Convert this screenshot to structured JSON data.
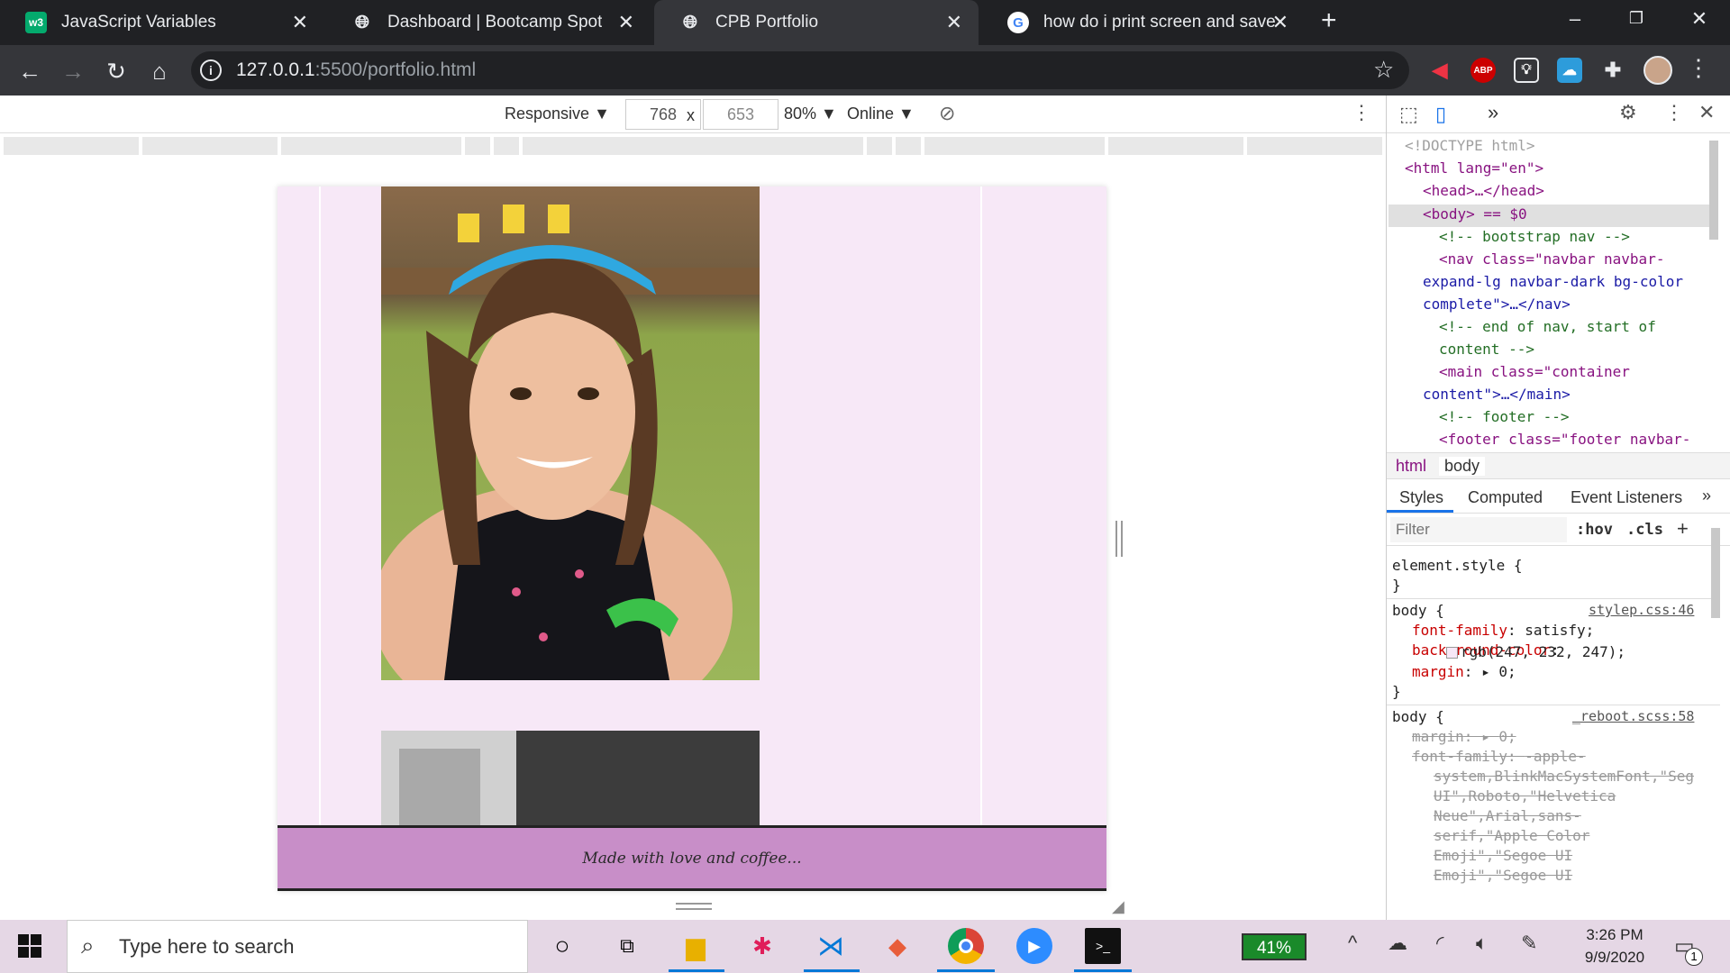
{
  "browser": {
    "tabs": [
      {
        "label": "JavaScript Variables",
        "icon": "w3schools-icon",
        "active": false
      },
      {
        "label": "Dashboard | Bootcamp Spot",
        "icon": "globe-icon",
        "active": false
      },
      {
        "label": "CPB Portfolio",
        "icon": "globe-icon",
        "active": true
      },
      {
        "label": "how do i print screen and save to",
        "icon": "google-icon",
        "active": false
      }
    ],
    "new_tab": "+",
    "url_host": "127.0.0.1",
    "url_rest": ":5500/portfolio.html",
    "extensions": [
      "ABP"
    ]
  },
  "device_toolbar": {
    "mode": "Responsive",
    "width": "768",
    "times": "x",
    "height": "653",
    "zoom": "80%",
    "network": "Online"
  },
  "page": {
    "footer_text": "Made with love and coffee..."
  },
  "devtools": {
    "dom": {
      "doctype": "<!DOCTYPE html>",
      "html_open": "<html lang=\"en\">",
      "head": "<head>…</head>",
      "body_line": "<body> == $0",
      "c1": "<!-- bootstrap nav -->",
      "nav1": "<nav class=\"navbar navbar-",
      "nav2": "expand-lg navbar-dark bg-color",
      "nav3": "complete\">…</nav>",
      "c2a": "<!-- end of nav, start of",
      "c2b": "content -->",
      "main1": "<main class=\"container",
      "main2": "content\">…</main>",
      "c3": "<!-- footer -->",
      "foot1": "<footer class=\"footer navbar-"
    },
    "breadcrumb": [
      "html",
      "body"
    ],
    "tabs": [
      "Styles",
      "Computed",
      "Event Listeners"
    ],
    "filter_placeholder": "Filter",
    "hov": ":hov",
    "cls": ".cls",
    "styles": {
      "element_style": "element.style {",
      "close": "}",
      "rule1_selector": "body {",
      "rule1_source": "stylep.css:46",
      "rule1_p1": "font-family",
      "rule1_v1": "satisfy;",
      "rule1_p2": "background-color",
      "rule1_v2": "rgb(247, 232, 247);",
      "rule1_p3": "margin",
      "rule1_v3": "0;",
      "rule2_selector": "body {",
      "rule2_source": "_reboot.scss:58",
      "rule2_p1": "margin",
      "rule2_v1": "0;",
      "rule2_p2": "font-family",
      "rule2_v2a": "-apple-",
      "rule2_v2b": "system,BlinkMacSystemFont,\"Seg",
      "rule2_v2c": "UI\",Roboto,\"Helvetica",
      "rule2_v2d": "Neue\",Arial,sans-",
      "rule2_v2e": "serif,\"Apple Color",
      "rule2_v2f": "Emoji\",\"Segoe UI",
      "rule2_v2g": "Emoji\",\"Segoe UI"
    }
  },
  "taskbar": {
    "search_placeholder": "Type here to search",
    "battery": "41%",
    "time": "3:26 PM",
    "date": "9/9/2020",
    "notifications": "1"
  }
}
